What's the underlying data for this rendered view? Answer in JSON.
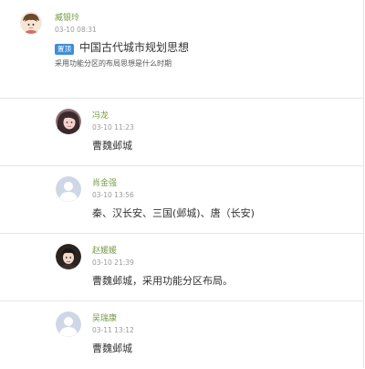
{
  "post": {
    "author": "臧银玲",
    "time": "03-10 08:31",
    "tag": "置顶",
    "title": "中国古代城市规划思想",
    "body": "采用功能分区的布局思想是什么时期"
  },
  "replies": [
    {
      "author": "冯龙",
      "time": "03-10 11:23",
      "content": "曹魏邺城"
    },
    {
      "author": "肖金强",
      "time": "03-10 13:56",
      "content": "秦、汉长安、三国(邺城)、唐（长安)"
    },
    {
      "author": "赵媛媛",
      "time": "03-10 21:39",
      "content": "曹魏邺城，采用功能分区布局。"
    },
    {
      "author": "吴瑞康",
      "time": "03-11 13:12",
      "content": "曹魏邺城"
    }
  ],
  "colors": {
    "accent": "#7a9a4a",
    "tag": "#3d8fd6"
  }
}
